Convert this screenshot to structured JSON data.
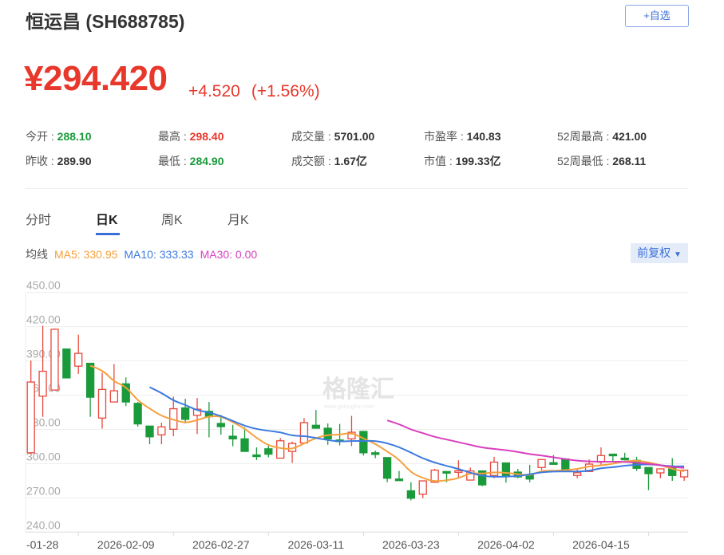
{
  "header": {
    "title": "恒运昌 (SH688785)",
    "watch_button": "+自选",
    "price": "¥294.420",
    "change": "+4.520",
    "change_pct": "(+1.56%)"
  },
  "stats": [
    {
      "label": "今开 : ",
      "value": "288.10",
      "color": "green"
    },
    {
      "label": "最高 : ",
      "value": "298.40",
      "color": "red"
    },
    {
      "label": "成交量 : ",
      "value": "5701.00",
      "color": ""
    },
    {
      "label": "市盈率 : ",
      "value": "140.83",
      "color": ""
    },
    {
      "label": "52周最高 : ",
      "value": "421.00",
      "color": ""
    },
    {
      "label": "昨收 : ",
      "value": "289.90",
      "color": ""
    },
    {
      "label": "最低 : ",
      "value": "284.90",
      "color": "green"
    },
    {
      "label": "成交额 : ",
      "value": "1.67亿",
      "color": ""
    },
    {
      "label": "市值 : ",
      "value": "199.33亿",
      "color": ""
    },
    {
      "label": "52周最低 : ",
      "value": "268.11",
      "color": ""
    }
  ],
  "tabs": [
    {
      "label": "分时",
      "active": false
    },
    {
      "label": "日K",
      "active": true
    },
    {
      "label": "周K",
      "active": false
    },
    {
      "label": "月K",
      "active": false
    }
  ],
  "ma_legend": {
    "label": "均线",
    "ma5": "MA5: 330.95",
    "ma10": "MA10: 333.33",
    "ma30": "MA30: 0.00"
  },
  "adjust_button": "前复权",
  "colors": {
    "up": "#e8483c",
    "down": "#1a9a3a",
    "ma5": "#f5a03c",
    "ma10": "#3d7be0",
    "ma30": "#d93fbf",
    "accent": "#3b6fd8"
  },
  "watermark": {
    "text": "格隆汇",
    "sub": "www.gelonghui.com"
  },
  "chart_data": {
    "type": "candlestick",
    "ylim": [
      240,
      450
    ],
    "yticks": [
      "450.00",
      "420.00",
      "390.00",
      "360.00",
      "330.00",
      "300.00",
      "270.00",
      "240.00"
    ],
    "xticks": [
      {
        "index": 0,
        "label": "-01-28"
      },
      {
        "index": 8,
        "label": "2026-02-09"
      },
      {
        "index": 16,
        "label": "2026-02-27"
      },
      {
        "index": 24,
        "label": "2026-03-11"
      },
      {
        "index": 32,
        "label": "2026-03-23"
      },
      {
        "index": 40,
        "label": "2026-04-02"
      },
      {
        "index": 48,
        "label": "2026-04-15"
      }
    ],
    "grid": true,
    "ma30_start_index": 30,
    "ohlc": [
      [
        309.5,
        371.5,
        390.3,
        308.3
      ],
      [
        359.1,
        380.9,
        420.7,
        341.0
      ],
      [
        364.5,
        417.7,
        418.4,
        364.5
      ],
      [
        400.4,
        375.1,
        400.4,
        375.1
      ],
      [
        385.4,
        396.6,
        413.0,
        378.6
      ],
      [
        387.9,
        358.2,
        387.9,
        341.0
      ],
      [
        339.9,
        365.0,
        379.7,
        330.6
      ],
      [
        354.0,
        363.8,
        387.2,
        354.0
      ],
      [
        369.9,
        354.0,
        375.5,
        350.5
      ],
      [
        352.8,
        334.8,
        354.0,
        332.4
      ],
      [
        332.9,
        323.5,
        332.9,
        317.0
      ],
      [
        325.2,
        332.2,
        335.9,
        317.0
      ],
      [
        330.1,
        348.1,
        358.7,
        324.0
      ],
      [
        348.8,
        338.8,
        356.8,
        335.2
      ],
      [
        342.3,
        347.7,
        357.5,
        325.9
      ],
      [
        345.8,
        341.1,
        354.0,
        323.0
      ],
      [
        335.2,
        332.4,
        342.7,
        325.4
      ],
      [
        324.0,
        321.7,
        334.0,
        315.3
      ],
      [
        321.7,
        310.7,
        331.7,
        310.7
      ],
      [
        307.6,
        306.4,
        314.2,
        303.2
      ],
      [
        313.0,
        308.3,
        316.5,
        305.5
      ],
      [
        304.8,
        320.0,
        322.4,
        304.8
      ],
      [
        310.7,
        317.7,
        319.3,
        300.6
      ],
      [
        318.1,
        335.9,
        339.9,
        318.1
      ],
      [
        333.6,
        331.0,
        347.0,
        330.6
      ],
      [
        331.0,
        321.7,
        335.2,
        316.5
      ],
      [
        320.7,
        319.8,
        334.8,
        316.0
      ],
      [
        321.7,
        327.5,
        341.8,
        315.3
      ],
      [
        328.2,
        309.5,
        328.7,
        307.1
      ],
      [
        309.5,
        309.0,
        311.4,
        304.8
      ],
      [
        305.3,
        287.2,
        305.3,
        283.7
      ],
      [
        286.5,
        285.4,
        293.6,
        285.4
      ],
      [
        276.2,
        269.7,
        283.7,
        267.8
      ],
      [
        273.2,
        284.9,
        284.9,
        269.7
      ],
      [
        283.7,
        294.3,
        295.4,
        283.3
      ],
      [
        293.1,
        292.6,
        293.1,
        283.7
      ],
      [
        292.9,
        293.8,
        302.9,
        287.2
      ],
      [
        285.6,
        293.6,
        296.6,
        285.6
      ],
      [
        293.6,
        281.4,
        293.6,
        280.2
      ],
      [
        289.6,
        301.3,
        306.0,
        287.2
      ],
      [
        300.6,
        289.6,
        300.6,
        283.3
      ],
      [
        292.6,
        288.4,
        295.4,
        287.2
      ],
      [
        290.3,
        286.5,
        299.0,
        283.7
      ],
      [
        296.6,
        303.6,
        303.6,
        294.3
      ],
      [
        300.8,
        300.1,
        307.6,
        299.6
      ],
      [
        304.1,
        293.6,
        304.6,
        293.6
      ],
      [
        289.6,
        292.0,
        295.4,
        287.2
      ],
      [
        293.1,
        299.6,
        303.6,
        293.1
      ],
      [
        301.3,
        307.1,
        314.2,
        297.8
      ],
      [
        308.3,
        307.1,
        308.3,
        301.0
      ],
      [
        304.8,
        304.3,
        309.5,
        302.9
      ],
      [
        302.9,
        295.9,
        306.0,
        293.6
      ],
      [
        296.6,
        291.2,
        296.6,
        276.7
      ],
      [
        291.9,
        295.4,
        295.4,
        287.2
      ],
      [
        296.6,
        289.6,
        304.8,
        284.9
      ],
      [
        288.4,
        294.3,
        294.3,
        284.9
      ]
    ]
  }
}
